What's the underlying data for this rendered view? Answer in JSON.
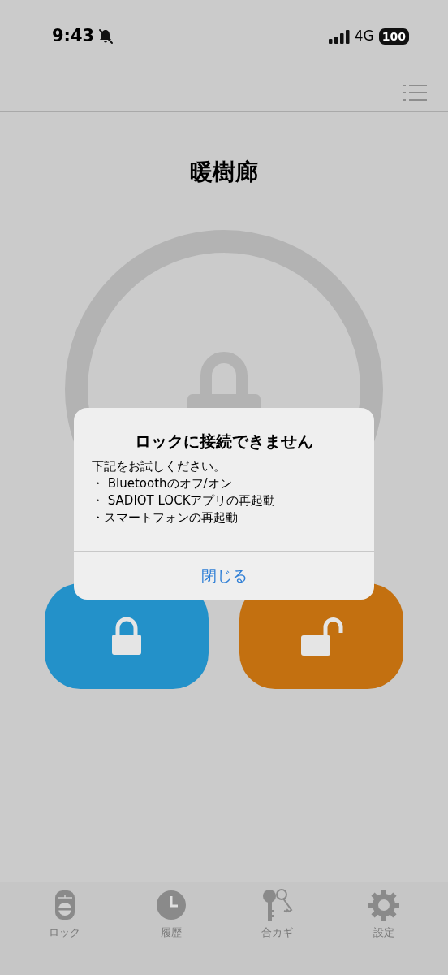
{
  "status_bar": {
    "time": "9:43",
    "network": "4G",
    "battery": "100"
  },
  "title": "暖樹廊",
  "lock_buttons": [
    {
      "kind": "lock",
      "color": "#2391c9"
    },
    {
      "kind": "unlock",
      "color": "#c37010"
    }
  ],
  "dialog": {
    "title": "ロックに接続できません",
    "message_lines": [
      "下記をお試しください。",
      "・ Bluetoothのオフ/オン",
      "・ SADIOT LOCKアプリの再起動",
      "・スマートフォンの再起動"
    ],
    "button": "閉じる"
  },
  "tab_bar": [
    {
      "kind": "lock",
      "label": "ロック"
    },
    {
      "kind": "history",
      "label": "履歴"
    },
    {
      "kind": "keys",
      "label": "合カギ"
    },
    {
      "kind": "settings",
      "label": "設定"
    }
  ]
}
